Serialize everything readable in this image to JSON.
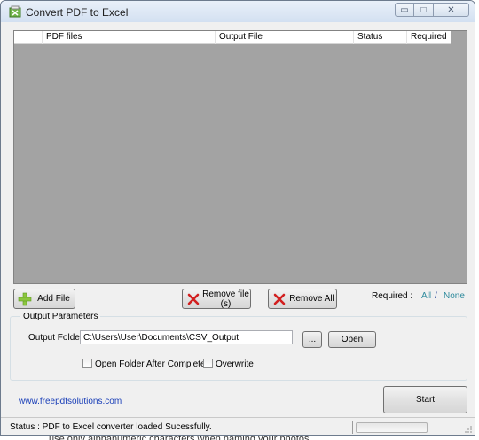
{
  "window": {
    "title": "Convert PDF to Excel",
    "controls": {
      "minimize": "▭",
      "maximize": "□",
      "close": "✕"
    }
  },
  "file_list": {
    "columns": [
      "",
      "PDF files",
      "Output File",
      "Status",
      "Required"
    ],
    "rows": []
  },
  "buttons": {
    "add_file": "Add File",
    "remove_file": "Remove file (s)",
    "remove_all": "Remove All",
    "browse": "...",
    "open": "Open",
    "start": "Start"
  },
  "required_filter": {
    "label": "Required :",
    "all": "All",
    "separator": "/",
    "none": "None"
  },
  "output_parameters": {
    "group_title": "Output Parameters",
    "folder_label": "Output Folder",
    "folder_value": "C:\\Users\\User\\Documents\\CSV_Output",
    "open_after_complete": {
      "label": "Open Folder After Complete",
      "checked": false
    },
    "overwrite": {
      "label": "Overwrite",
      "checked": false
    }
  },
  "website_link": "www.freepdfsolutions.com",
  "status": {
    "text": "Status :  PDF to Excel converter loaded Sucessfully.",
    "progress_percent": 0
  },
  "icons": {
    "app": "excel-pdf-icon",
    "add": "green-plus-icon",
    "remove": "red-x-icon"
  },
  "colors": {
    "list_background": "#a3a3a3",
    "link": "#1a3fb8",
    "required_link": "#2d8a9c"
  },
  "background_text": "use only alphanumeric characters when naming your photos"
}
